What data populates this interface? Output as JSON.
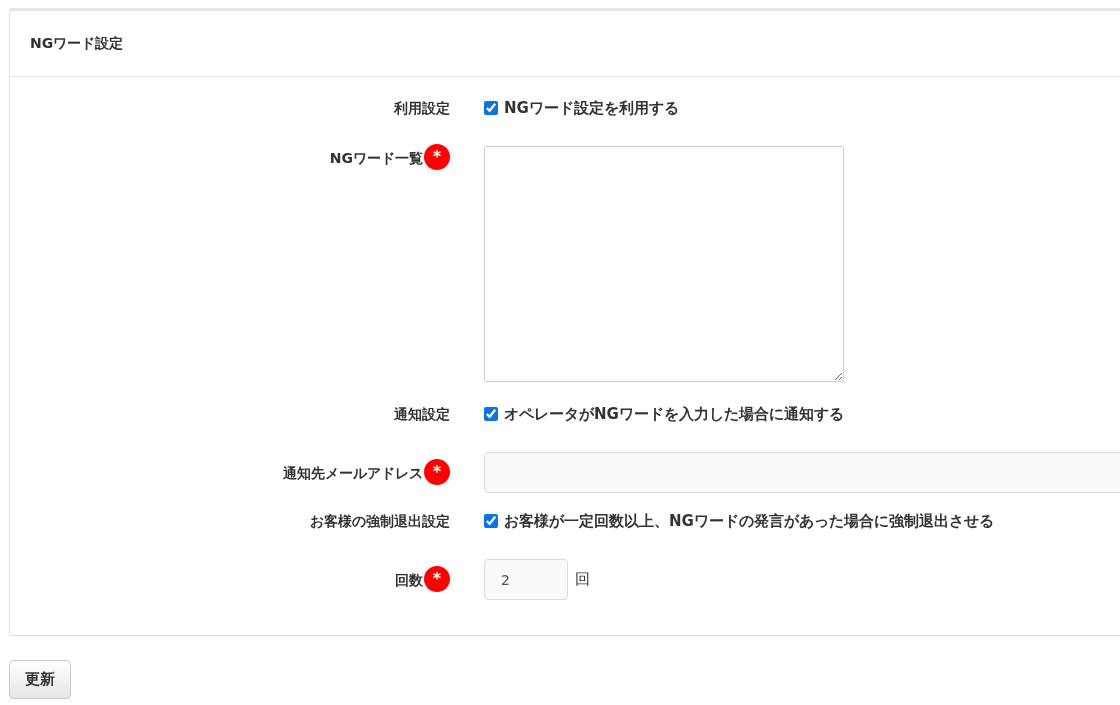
{
  "panel": {
    "title": "NGワード設定"
  },
  "fields": [
    {
      "kind": "checkbox",
      "label": "利用設定",
      "checked": true,
      "text": "NGワード設定を利用する"
    },
    {
      "kind": "textarea",
      "label": "NGワード一覧",
      "required_mark": "*"
    },
    {
      "kind": "checkbox",
      "label": "通知設定",
      "checked": true,
      "text": "オペレータがNGワードを入力した場合に通知する"
    },
    {
      "kind": "text",
      "label": "通知先メールアドレス",
      "required_mark": "*"
    },
    {
      "kind": "checkbox",
      "label": "お客様の強制退出設定",
      "checked": true,
      "text": "お客様が一定回数以上、NGワードの発言があった場合に強制退出させる"
    },
    {
      "kind": "number",
      "label": "回数",
      "required_mark": "*",
      "value": "2",
      "unit": "回"
    }
  ],
  "buttons": [
    "更新"
  ]
}
